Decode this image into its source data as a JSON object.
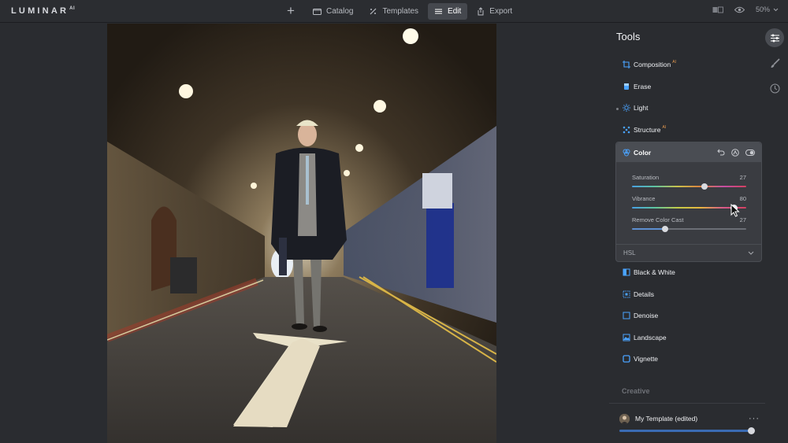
{
  "app": {
    "logo": "LUMINAR",
    "logo_sup": "AI"
  },
  "topnav": {
    "items": [
      {
        "label": "Catalog",
        "icon": "catalog-icon"
      },
      {
        "label": "Templates",
        "icon": "templates-icon"
      },
      {
        "label": "Edit",
        "icon": "edit-icon",
        "active": true
      },
      {
        "label": "Export",
        "icon": "export-icon"
      }
    ],
    "zoom": "50%"
  },
  "panel": {
    "title": "Tools",
    "tools_top": [
      {
        "label": "Composition",
        "ai": true
      },
      {
        "label": "Erase",
        "ai": false
      },
      {
        "label": "Light",
        "ai": false
      },
      {
        "label": "Structure",
        "ai": true
      }
    ],
    "ai_badge": "AI",
    "color_card": {
      "title": "Color",
      "sliders": [
        {
          "label": "Saturation",
          "value": "27"
        },
        {
          "label": "Vibrance",
          "value": "80"
        },
        {
          "label": "Remove Color Cast",
          "value": "27"
        }
      ],
      "hsl_label": "HSL"
    },
    "tools_bottom": [
      {
        "label": "Black & White"
      },
      {
        "label": "Details"
      },
      {
        "label": "Denoise"
      },
      {
        "label": "Landscape"
      },
      {
        "label": "Vignette"
      }
    ],
    "section": "Creative",
    "template": {
      "name": "My Template (edited)",
      "amount": 1.0
    }
  },
  "colors": {
    "accent": "#3a6bb3",
    "ai_badge": "#e79a4f"
  }
}
